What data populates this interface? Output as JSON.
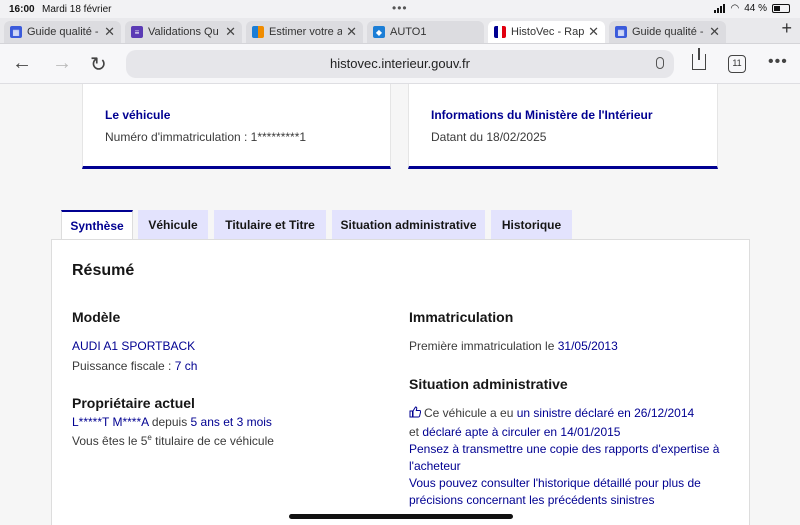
{
  "status_bar": {
    "time": "16:00",
    "date": "Mardi 18 février",
    "battery": "44 %"
  },
  "browser_tabs": [
    {
      "title": "Guide qualité -",
      "fav_color": "#3b5bdb",
      "active": false
    },
    {
      "title": "Validations Qu",
      "fav_color": "#5b3bb5",
      "active": false
    },
    {
      "title": "Estimer votre a",
      "fav_color": "#f08c00",
      "active": false
    },
    {
      "title": "AUTO1",
      "fav_color": "#1c7ed6",
      "active": false
    },
    {
      "title": "HistoVec - Rap",
      "fav_color": "#e03131",
      "active": true
    },
    {
      "title": "Guide qualité -",
      "fav_color": "#3b5bdb",
      "active": false
    }
  ],
  "address_bar": {
    "url": "histovec.interieur.gouv.fr",
    "tab_count": "11"
  },
  "card_vehicle": {
    "title": "Le véhicule",
    "text": "Numéro d'immatriculation : 1*********1"
  },
  "card_ministry": {
    "title": "Informations du Ministère de l'Intérieur",
    "text": "Datant du 18/02/2025"
  },
  "page_tabs": [
    "Synthèse",
    "Véhicule",
    "Titulaire et Titre",
    "Situation administrative",
    "Historique"
  ],
  "resume": {
    "title": "Résumé",
    "model": {
      "heading": "Modèle",
      "name": "AUDI A1 SPORTBACK",
      "puissance_label": "Puissance fiscale : ",
      "puissance_value": "7 ch"
    },
    "owner": {
      "heading": "Propriétaire actuel",
      "name": "L*****T M****A",
      "since_label": " depuis ",
      "since_value": "5 ans et 3 mois",
      "rank_prefix": "Vous êtes le 5",
      "rank_sup": "e",
      "rank_suffix": " titulaire de ce véhicule"
    },
    "immat": {
      "heading": "Immatriculation",
      "label": "Première immatriculation le ",
      "date": "31/05/2013"
    },
    "situation": {
      "heading": "Situation administrative",
      "sinistre_prefix": "Ce véhicule a eu ",
      "sinistre_link": "un sinistre déclaré en 26/12/2014",
      "apte_prefix": "et ",
      "apte_link": "déclaré apte à circuler en 14/01/2015",
      "rapports_1": "Pensez à transmettre une copie des rapports d'expertise à",
      "rapports_2": "l'acheteur",
      "historique_1": "Vous pouvez consulter l'historique détaillé pour plus de",
      "historique_2": "précisions concernant les précédents sinistres"
    }
  },
  "colors": {
    "accent": "#000091",
    "tab_inactive": "#e3e3fd"
  }
}
